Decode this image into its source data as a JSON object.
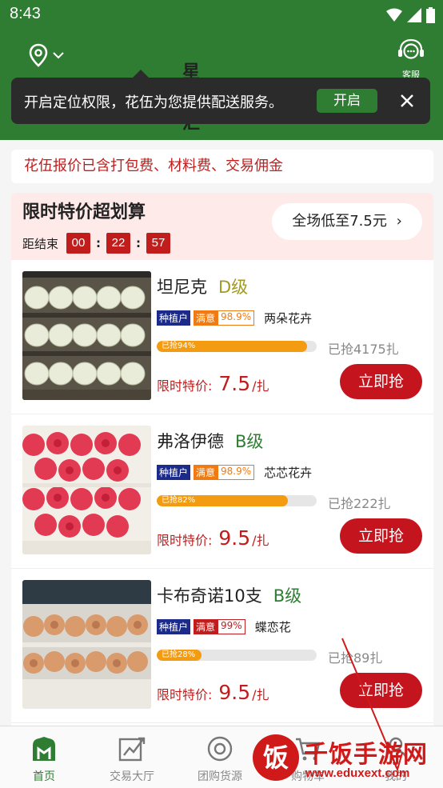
{
  "status_bar": {
    "time": "8:43"
  },
  "header": {
    "location": "星河汇",
    "service_label": "客服"
  },
  "tip": {
    "text": "开启定位权限，花伍为您提供配送服务。",
    "open_label": "开启"
  },
  "notice": "花伍报价已含打包费、材料费、交易佣金",
  "promo": {
    "title": "限时特价超划算",
    "countdown_label": "距结束",
    "hours": "00",
    "minutes": "22",
    "seconds": "57",
    "lowest_label": "全场低至7.5元"
  },
  "items": [
    {
      "name": "坦尼克",
      "grade": "D级",
      "grade_color": "#a29a1f",
      "tag_planter": "种植户",
      "tag_sat": "满意",
      "sat_pct": "98.9%",
      "sat_color": "#f07b12",
      "shop": "两朵花卉",
      "progress_label": "已抢94%",
      "progress": 0.94,
      "sold": "已抢4175扎",
      "price_label": "限时特价:",
      "price": "7.5",
      "unit": "/扎",
      "buy_label": "立即抢"
    },
    {
      "name": "弗洛伊德",
      "grade": "B级",
      "grade_color": "#2f7d32",
      "tag_planter": "种植户",
      "tag_sat": "满意",
      "sat_pct": "98.9%",
      "sat_color": "#f07b12",
      "shop": "芯芯花卉",
      "progress_label": "已抢82%",
      "progress": 0.82,
      "sold": "已抢222扎",
      "price_label": "限时特价:",
      "price": "9.5",
      "unit": "/扎",
      "buy_label": "立即抢"
    },
    {
      "name": "卡布奇诺10支",
      "grade": "B级",
      "grade_color": "#2f7d32",
      "tag_planter": "种植户",
      "tag_sat": "满意",
      "sat_pct": "99%",
      "sat_color": "#c21d1d",
      "shop": "蝶恋花",
      "progress_label": "已抢28%",
      "progress": 0.28,
      "sold": "已抢89扎",
      "price_label": "限时特价:",
      "price": "9.5",
      "unit": "/扎",
      "buy_label": "立即抢"
    }
  ],
  "tabs": [
    {
      "label": "首页",
      "icon": "home-icon"
    },
    {
      "label": "交易大厅",
      "icon": "trend-icon"
    },
    {
      "label": "团购货源",
      "icon": "group-icon"
    },
    {
      "label": "购物车",
      "icon": "cart-icon"
    },
    {
      "label": "我的",
      "icon": "user-icon"
    }
  ],
  "watermark": {
    "brand": "饭",
    "name": "千饭手游网",
    "url": "www.eduxext.com"
  },
  "colors": {
    "brand_green": "#2f7d32",
    "accent_red": "#c4141e"
  }
}
